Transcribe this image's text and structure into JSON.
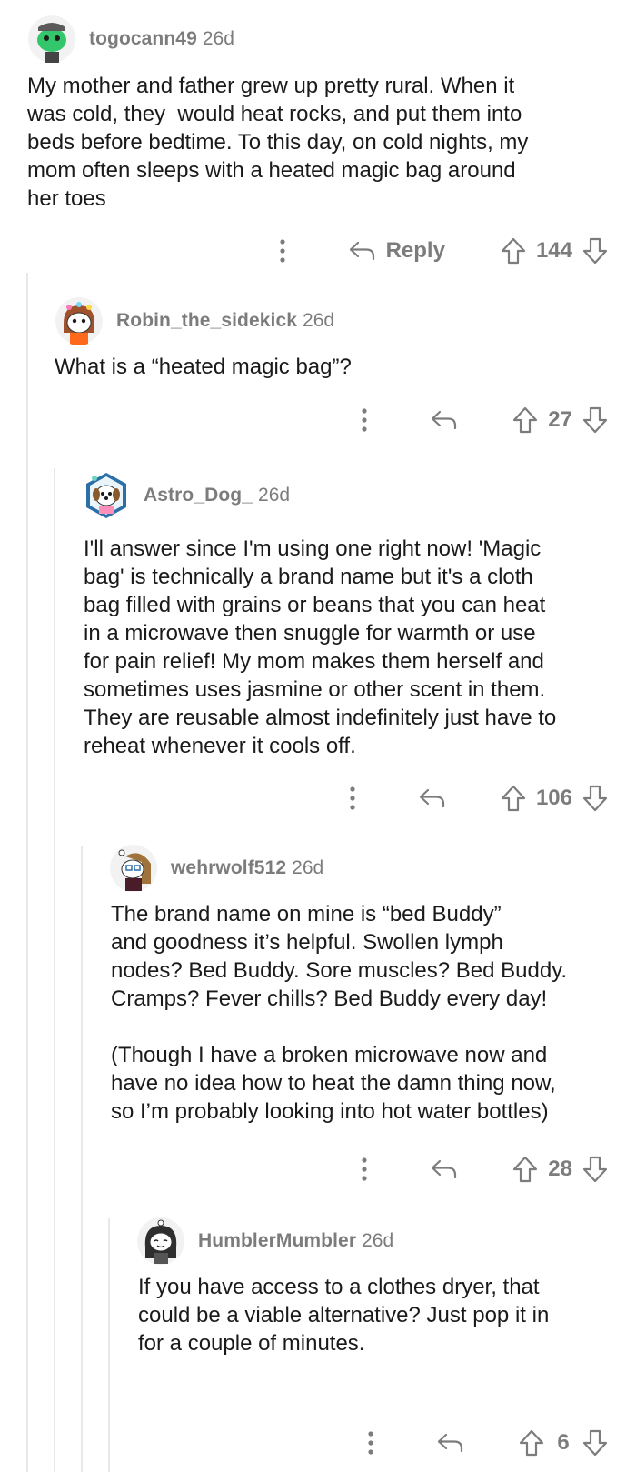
{
  "comments": [
    {
      "author": "togocann49",
      "age": "26d",
      "avatar_icon": "green-snoo-avatar",
      "body": "My mother and father grew up pretty rural. When it\nwas cold, they  would heat rocks, and put them into\nbeds before bedtime. To this day, on cold nights, my\nmom often sleeps with a heated magic bag around\nher toes",
      "reply_label": "Reply",
      "score": "144"
    },
    {
      "author": "Robin_the_sidekick",
      "age": "26d",
      "avatar_icon": "flower-crown-snoo-avatar",
      "body": "What is a “heated magic bag”?",
      "score": "27"
    },
    {
      "author": "Astro_Dog_",
      "age": "26d",
      "avatar_icon": "dog-hexagon-avatar",
      "body": "I'll answer since I'm using one right now! 'Magic\nbag' is technically a brand name but it's a cloth\nbag filled with grains or beans that you can heat\nin a microwave then snuggle for warmth or use\nfor pain relief! My mom makes them herself and\nsometimes uses jasmine or other scent in them.\nThey are reusable almost indefinitely just have to\nreheat whenever it cools off.",
      "score": "106"
    },
    {
      "author": "wehrwolf512",
      "age": "26d",
      "avatar_icon": "brown-hair-snoo-avatar",
      "body": "The brand name on mine is “bed Buddy”\nand goodness it’s helpful. Swollen lymph\nnodes? Bed Buddy. Sore muscles? Bed Buddy.\nCramps? Fever chills? Bed Buddy every day!\n\n(Though I have a broken microwave now and\nhave no idea how to heat the damn thing now,\nso I’m probably looking into hot water bottles)",
      "score": "28"
    },
    {
      "author": "HumblerMumbler",
      "age": "26d",
      "avatar_icon": "dark-hair-snoo-avatar",
      "body": "If you have access to a clothes dryer, that\ncould be a viable alternative? Just pop it in\nfor a couple of minutes.",
      "score": "6"
    }
  ],
  "colors": {
    "meta_gray": "#7c7c7c",
    "text": "#1a1a1b",
    "thread_line": "#e8e8e8"
  }
}
